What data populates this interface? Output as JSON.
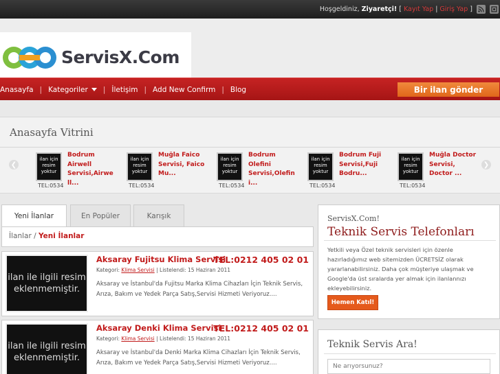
{
  "topbar": {
    "greeting": "Hoşgeldiniz,",
    "user": "Ziyaretçi!",
    "sep_open": "[",
    "register": "Kayıt Yap",
    "divider": "|",
    "login": "Giriş Yap",
    "sep_close": "]",
    "icons": [
      "rss-icon",
      "social-icon"
    ]
  },
  "logo": {
    "text": "ServisX.Com"
  },
  "nav": {
    "items": [
      "Anasayfa",
      "Kategoriler",
      "İletişim",
      "Add New Confirm",
      "Blog"
    ],
    "separator": "|",
    "post_button": "Bir ilan gönder"
  },
  "vitrin": {
    "title": "Anasayfa Vitrini",
    "items": [
      {
        "thumb": "ilan için resim yoktur",
        "title": "Bodrum Airwell Servisi,Airwe ll...",
        "phone": "TEL:0534"
      },
      {
        "thumb": "ilan için resim yoktur",
        "title": "Muğla Faico Servisi, Faico Mu...",
        "phone": "TEL:0534"
      },
      {
        "thumb": "ilan için resim yoktur",
        "title": "Bodrum Olefini Servisi,Olefin i...",
        "phone": "TEL:0534"
      },
      {
        "thumb": "ilan için resim yoktur",
        "title": "Bodrum Fuji Servisi,Fuji Bodru...",
        "phone": "TEL:0534"
      },
      {
        "thumb": "ilan için resim yoktur",
        "title": "Muğla Doctor Servisi, Doctor ...",
        "phone": "TEL:0534"
      }
    ]
  },
  "tabs": [
    "Yeni İlanlar",
    "En Popüler",
    "Karışık"
  ],
  "breadcrumb": {
    "root": "İlanlar",
    "sep": " / ",
    "current": "Yeni İlanlar"
  },
  "listings": [
    {
      "thumb": "ilan ile ilgili resim eklenmemiştir.",
      "title": "Aksaray Fujitsu Klima Servisi",
      "phone": "TEL:0212 405 02 01",
      "category_label": "Kategori:",
      "category": "Klima Servisi",
      "listed": "| Listelendi: 15 Haziran 2011",
      "desc": "Aksaray ve İstanbul'da Fujitsu Marka Klima Cihazları İçin Teknik Servis, Arıza, Bakım ve Yedek Parça Satış,Servisi Hizmeti Veriyoruz...."
    },
    {
      "thumb": "ilan ile ilgili resim eklenmemiştir.",
      "title": "Aksaray Denki Klima Servisi",
      "phone": "TEL:0212 405 02 01",
      "category_label": "Kategori:",
      "category": "Klima Servisi",
      "listed": "| Listelendi: 15 Haziran 2011",
      "desc": "Aksaray ve İstanbul'da Denki Marka Klima Cihazları İçin Teknik Servis, Arıza, Bakım ve Yedek Parça Satış,Servisi Hizmeti Veriyoruz...."
    }
  ],
  "sidebar": {
    "promo": {
      "small": "ServisX.Com!",
      "title": "Teknik Servis Telefonları",
      "text": "Yetkili veya Özel teknik servisleri için özenle hazırladığımız web sitemizden ÜCRETSİZ olarak yararlanabilirsiniz. Daha çok müşteriye ulaşmak ve Google'da üst sıralarda yer almak için ilanlannızı ekleyebilirsiniz.",
      "button": "Hemen Katıl!"
    },
    "search": {
      "title": "Teknik Servis Ara!",
      "placeholder": "Ne arıyorsunuz?"
    }
  },
  "colors": {
    "brand_red": "#c11b1b",
    "nav_red": "#b71c1c",
    "orange": "#e8701f"
  }
}
